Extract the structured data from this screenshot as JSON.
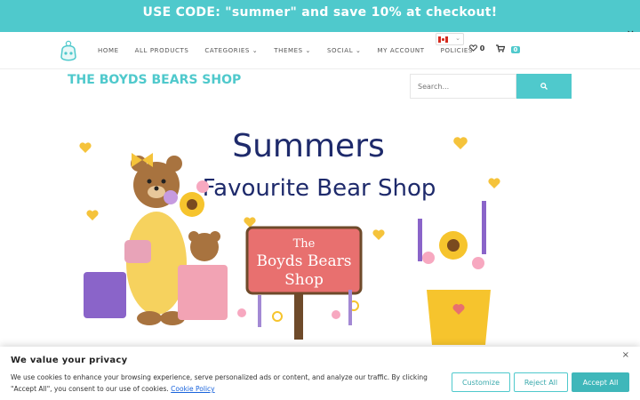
{
  "promo": {
    "text": "USE CODE: \"summer\" and save 10% at checkout!",
    "close": "×"
  },
  "nav": {
    "items": [
      "HOME",
      "ALL PRODUCTS",
      "CATEGORIES",
      "THEMES",
      "SOCIAL",
      "MY ACCOUNT",
      "POLICIES"
    ],
    "dropdown_caret": "⌄",
    "wishlist_count": "0",
    "cart_count": "0"
  },
  "shop_title": "THE BOYDS BEARS SHOP",
  "search": {
    "placeholder": "Search..."
  },
  "banner": {
    "headline_1": "Summers",
    "headline_2": "Favourite Bear Shop",
    "sign_1": "The",
    "sign_2": "Boyds Bears",
    "sign_3": "Shop"
  },
  "cookie": {
    "title": "We value your privacy",
    "text": "We use cookies to enhance your browsing experience, serve personalized ads or content, and analyze our traffic. By clicking \"Accept All\", you consent to our use of cookies.",
    "link": "Cookie Policy",
    "close": "×",
    "customize": "Customize",
    "reject": "Reject All",
    "accept": "Accept All"
  },
  "colors": {
    "accent": "#4fc9cc",
    "heading": "#1e2a6b",
    "sign": "#e8706f"
  },
  "icons": [
    "logo-icon",
    "flag-canada-icon",
    "heart-icon",
    "cart-icon",
    "search-icon",
    "close-icon"
  ]
}
